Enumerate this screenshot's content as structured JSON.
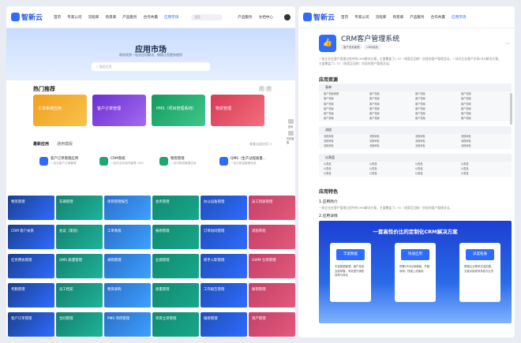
{
  "left": {
    "logo": "智新云",
    "nav": [
      "首页",
      "专家公司",
      "流程库",
      "场景库",
      "产品服务",
      "合作共赢",
      "应用市场"
    ],
    "search_placeholder": "搜索",
    "nav_right": [
      "产品服务",
      "文档中心"
    ],
    "hero": {
      "title": "应用市场",
      "subtitle": "帮你找到一站式应用解决，模版让您更快使用",
      "placeholder": "搜索应用"
    },
    "featured_title": "热门推荐",
    "featured": [
      {
        "label": "工单系统应用",
        "color": "#f0a020"
      },
      {
        "label": "客户订单管理",
        "color": "#7b3fd9"
      },
      {
        "label": "PMS（项目管理系统）",
        "color": "#20a770"
      },
      {
        "label": "物资管理",
        "color": "#e2485b"
      }
    ],
    "tabs": [
      "最新应用",
      "通用模版"
    ],
    "more": "查看全部应用 >",
    "recent": [
      {
        "title": "客户订单管理应用",
        "desc": "一站式客户订单管理",
        "color": "#2f6bff"
      },
      {
        "title": "CRM系统",
        "desc": "一站式业务协同管理 CRM",
        "color": "#20a770"
      },
      {
        "title": "物资管理",
        "desc": "一站式物资管理应用",
        "color": "#20a770"
      },
      {
        "title": "QMS（生产过程质量...",
        "desc": "一站式质量管理系统",
        "color": "#2f6bff"
      }
    ],
    "side": [
      "咨询",
      "在线客服"
    ],
    "tiles": [
      [
        "物资管理",
        "车辆管理",
        "项目管理报告",
        "会务管理",
        "办公设备管理",
        "员工资质管理"
      ],
      [
        "CRM 客户关系",
        "会议（策划）",
        "工单系统",
        "报修管理",
        "订单协同管理",
        "流程审批"
      ],
      [
        "任务费协管理",
        "QMS 质量管理",
        "采购管理",
        "业绩管理",
        "新手入职管理",
        "GWM 仓库管理"
      ],
      [
        "考勤管理",
        "员工档案",
        "物资采购",
        "质量管理",
        "工作报告管理",
        "报销管理"
      ],
      [
        "客户订单管理",
        "合同管理",
        "PMS 项目管理",
        "项目立项管理",
        "报修管理",
        "资产管理"
      ]
    ],
    "tile_colors": [
      "#2f6bff",
      "#1fb39a",
      "#3ea0ff",
      "#19a78a",
      "#2f6bff",
      "#e25a7a"
    ]
  },
  "right": {
    "logo": "智新云",
    "nav": [
      "首页",
      "专家公司",
      "流程库",
      "场景库",
      "产品服务",
      "合作共赢",
      "应用市场"
    ],
    "app_icon": "👍",
    "app_title": "CRM客户管理系统",
    "chips": [
      "客户关系管理",
      "CRM系统"
    ],
    "share": "⋯",
    "desc": "一款企业在客户管理过程中的CRM解决方案，主要覆盖了L TO（线索至回款）阶段的客户管理活动，一站式企业客户关系CRM解决方案，主要覆盖了L TO（线索至回款）阶段的客户管理活动。",
    "resources_title": "应用资源",
    "panels": [
      {
        "name": "表单",
        "rows": [
          [
            "客户档案管理",
            "客户档案",
            "客户档案",
            "客户档案"
          ],
          [
            "客户档案",
            "客户档案",
            "客户档案",
            "客户档案"
          ],
          [
            "客户档案",
            "客户档案",
            "客户档案",
            "客户档案"
          ],
          [
            "客户档案",
            "客户档案",
            "客户档案",
            "客户档案"
          ],
          [
            "客户档案",
            "客户档案",
            "客户档案",
            "客户档案"
          ],
          [
            "客户档案",
            "客户档案",
            "客户档案",
            "客户档案"
          ]
        ]
      },
      {
        "name": "流程",
        "rows": [
          [
            "流程审批",
            "流程审批",
            "流程审批",
            "流程审批"
          ],
          [
            "流程审批",
            "流程审批",
            "流程审批",
            "流程审批"
          ],
          [
            "流程审批",
            "流程审批",
            "流程审批",
            "流程审批"
          ]
        ]
      },
      {
        "name": "仪表盘",
        "rows": [
          [
            "仪表盘",
            "仪表盘",
            "仪表盘",
            "仪表盘"
          ],
          [
            "仪表盘",
            "仪表盘",
            "仪表盘",
            "仪表盘"
          ],
          [
            "仪表盘",
            "仪表盘",
            "仪表盘",
            "仪表盘"
          ]
        ]
      }
    ],
    "features_title": "应用特色",
    "intro_title": "1.应用简介",
    "intro_desc": "一款企业在客户管理过程中的CRM解决方案，主要覆盖了L TO（线索至回款）阶段的客户管理活动。",
    "detail_title": "2.应用详情",
    "banner_title": "一套高性价比的定制化CRM解决方案",
    "cards": [
      {
        "badge": "丰富数据",
        "desc": "丰富数据管理，客户信息全面掌握，有效提升销售效率与转化"
      },
      {
        "badge": "快速启用",
        "desc": "预置CRM应用模板，开箱即用，快速上线使用"
      },
      {
        "badge": "深度拓展",
        "desc": "根据企业需求灵活拓展，无缝对接现有系统与业务"
      }
    ]
  }
}
